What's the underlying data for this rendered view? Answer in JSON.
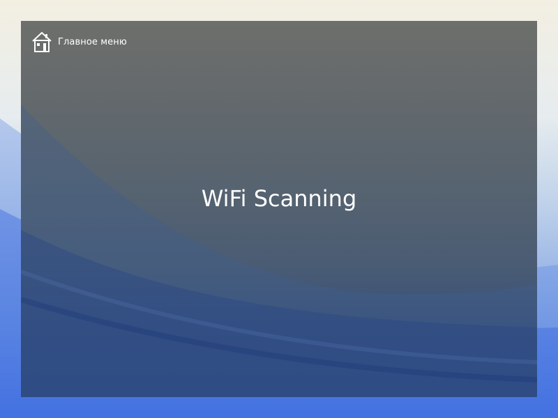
{
  "colors": {
    "overlay_top": "#6d6f6b",
    "overlay_bottom": "#2d4a82",
    "wallpaper_top": "#f3efe2",
    "wallpaper_bottom": "#3f6fe0",
    "text": "#ffffff"
  },
  "nav": {
    "home_icon": "house-icon",
    "home_label": "Главное меню"
  },
  "main": {
    "title": "WiFi Scanning"
  }
}
